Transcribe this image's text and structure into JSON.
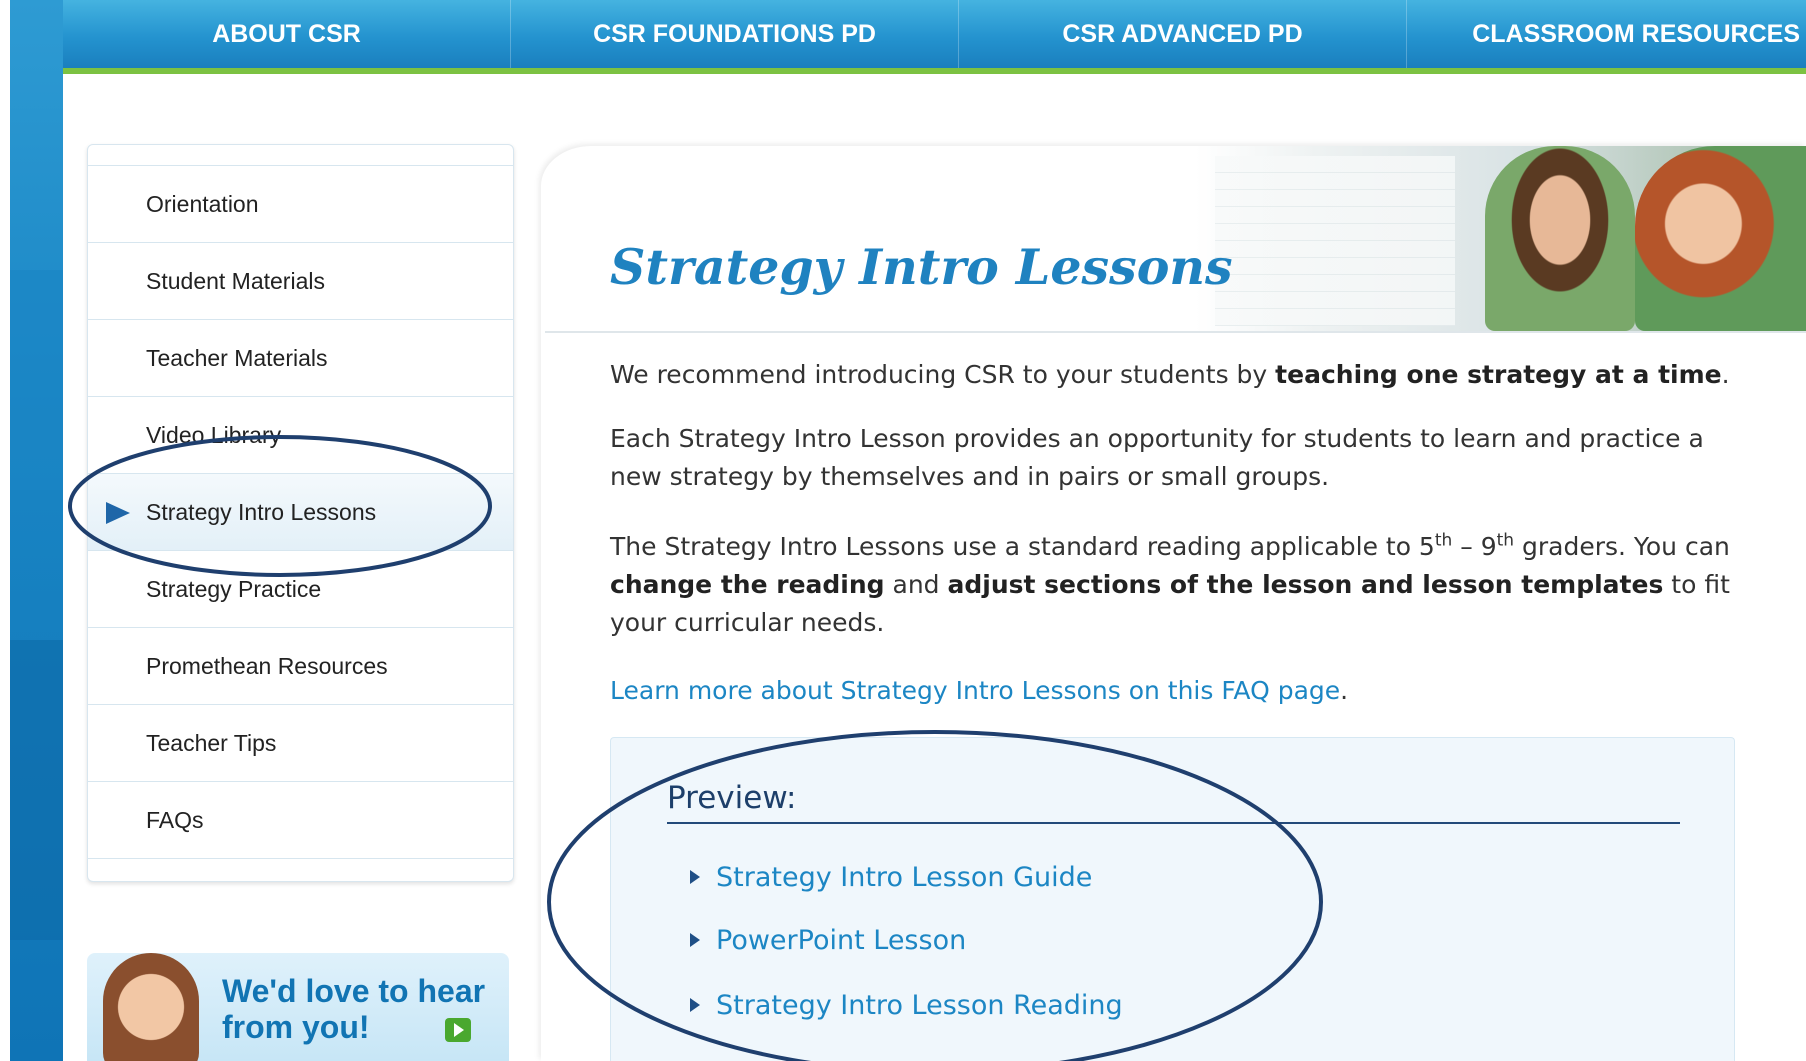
{
  "nav": {
    "items": [
      "ABOUT CSR",
      "CSR FOUNDATIONS PD",
      "CSR ADVANCED PD",
      "CLASSROOM RESOURCES"
    ]
  },
  "sidebar": {
    "items": [
      {
        "label": "Orientation"
      },
      {
        "label": "Student Materials"
      },
      {
        "label": "Teacher Materials"
      },
      {
        "label": "Video Library"
      },
      {
        "label": "Strategy Intro Lessons",
        "active": true
      },
      {
        "label": "Strategy Practice"
      },
      {
        "label": "Promethean Resources"
      },
      {
        "label": "Teacher Tips"
      },
      {
        "label": "FAQs"
      }
    ]
  },
  "feedback": {
    "line1": "We'd love to hear",
    "line2": "from you!"
  },
  "main": {
    "title": "Strategy Intro Lessons",
    "p1_pre": "We recommend introducing CSR to your students by ",
    "p1_bold": "teaching one strategy at a time",
    "p1_post": ".",
    "p2": "Each Strategy Intro Lesson provides an opportunity for students to learn and practice a new strategy by themselves and in pairs or small groups.",
    "p3_a": "The Strategy Intro Lessons use a standard reading applicable to 5",
    "p3_sup1": "th",
    "p3_b": " – 9",
    "p3_sup2": "th",
    "p3_c": " graders. You can ",
    "p3_bold1": "change the reading",
    "p3_d": " and ",
    "p3_bold2": "adjust sections of the lesson and lesson templates",
    "p3_e": " to fit your curricular needs.",
    "faq_link": "Learn more about Strategy Intro Lessons on this FAQ page",
    "faq_dot": "."
  },
  "preview": {
    "heading": "Preview:",
    "links": [
      "Strategy Intro Lesson Guide",
      "PowerPoint Lesson",
      "Strategy Intro Lesson Reading"
    ]
  },
  "colors": {
    "nav_blue": "#2493cf",
    "nav_green_rule": "#7cc242",
    "link_blue": "#1c86c4",
    "title_blue": "#1f82c0",
    "annotation_ellipse": "#1f3f6e"
  }
}
